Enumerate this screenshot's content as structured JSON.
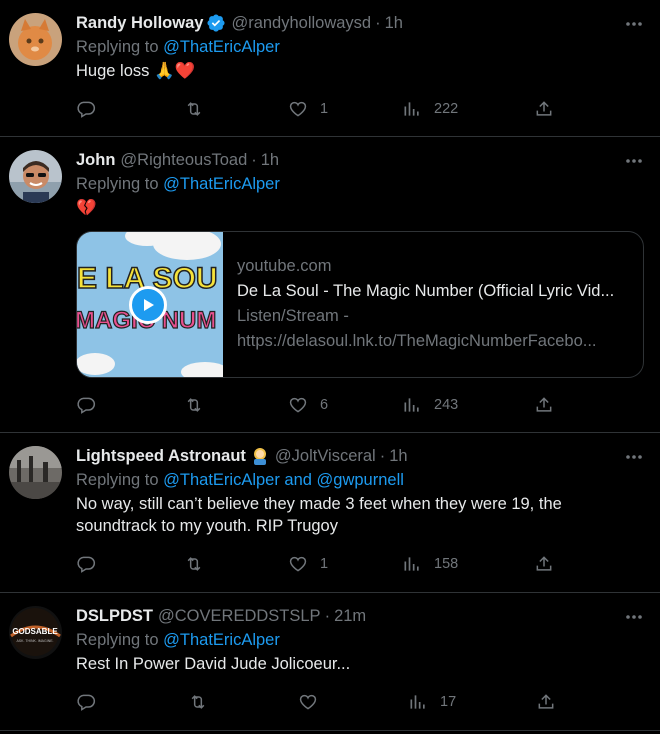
{
  "tweets": [
    {
      "name": "Randy Holloway",
      "verified": true,
      "handle": "@randyhollowaysd",
      "time": "1h",
      "replying_prefix": "Replying to ",
      "replying_to": "@ThatEricAlper",
      "text": "Huge loss 🙏❤️",
      "replies": "",
      "retweets": "",
      "likes": "1",
      "views": "222"
    },
    {
      "name": "John",
      "handle": "@RighteousToad",
      "time": "1h",
      "replying_prefix": "Replying to ",
      "replying_to": "@ThatEricAlper",
      "text": "💔",
      "card": {
        "domain": "youtube.com",
        "title": "De La Soul - The Magic Number (Official Lyric Vid...",
        "desc_line1": "Listen/Stream -",
        "desc_line2": "https://delasoul.lnk.to/TheMagicNumberFacebo...",
        "thumb_top": "E LA SOU",
        "thumb_bottom": "MAGIC NUM"
      },
      "likes": "6",
      "views": "243"
    },
    {
      "name": "Lightspeed Astronaut",
      "handle": "@JoltVisceral",
      "time": "1h",
      "replying_prefix": "Replying to ",
      "replying_to": "@ThatEricAlper and @gwpurnell",
      "text": "No way, still can’t believe they made 3 feet when they were 19, the soundtrack to my youth.  RIP Trugoy",
      "likes": "1",
      "views": "158"
    },
    {
      "name": "DSLPDST",
      "handle": "@COVEREDDSTSLP",
      "time": "21m",
      "replying_prefix": "Replying to ",
      "replying_to": "@ThatEricAlper",
      "text": "Rest In Power David Jude Jolicoeur...",
      "avatar_text": "GODSABLE",
      "avatar_sub": "ASK. THINK. IMAGINE.",
      "likes": "",
      "views": "17"
    }
  ],
  "sep": "·",
  "colors": {
    "accent": "#1d9bf0",
    "muted": "#71767b",
    "text": "#e7e9ea",
    "border": "#2f3336"
  }
}
